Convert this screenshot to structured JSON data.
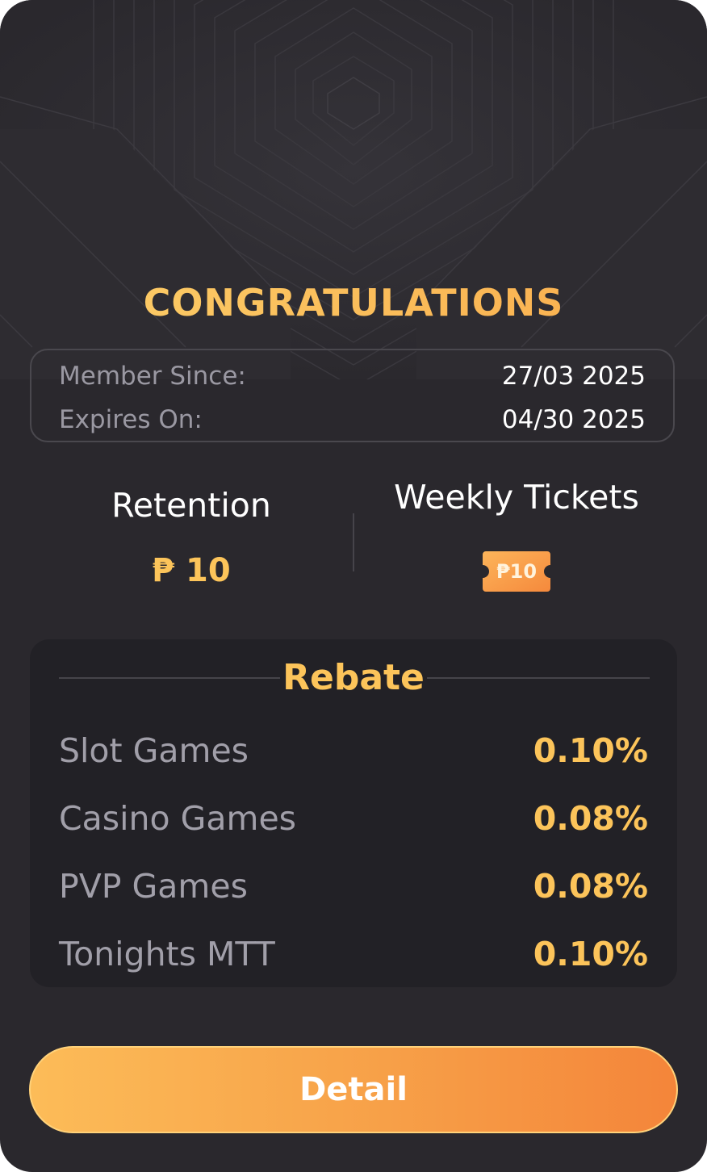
{
  "header": {
    "title": "CONGRATULATIONS"
  },
  "membership": {
    "member_since_label": "Member Since:",
    "member_since_value": "27/03 2025",
    "expires_label": "Expires On:",
    "expires_value": "04/30 2025"
  },
  "stats": {
    "retention_label": "Retention",
    "retention_value": "₱ 10",
    "weekly_tickets_label": "Weekly Tickets",
    "ticket_value": "₱10"
  },
  "rebate": {
    "title": "Rebate",
    "items": [
      {
        "name": "Slot Games",
        "value": "0.10%"
      },
      {
        "name": "Casino Games",
        "value": "0.08%"
      },
      {
        "name": "PVP Games",
        "value": "0.08%"
      },
      {
        "name": "Tonights MTT",
        "value": "0.10%"
      }
    ]
  },
  "actions": {
    "detail_label": "Detail"
  },
  "colors": {
    "background": "#2a282d",
    "panel": "#222126",
    "accent_gold": "#fcc45a",
    "accent_orange": "#f4853a"
  },
  "icons": {
    "ticket": "ticket-icon",
    "background": "hexagon-pattern"
  }
}
